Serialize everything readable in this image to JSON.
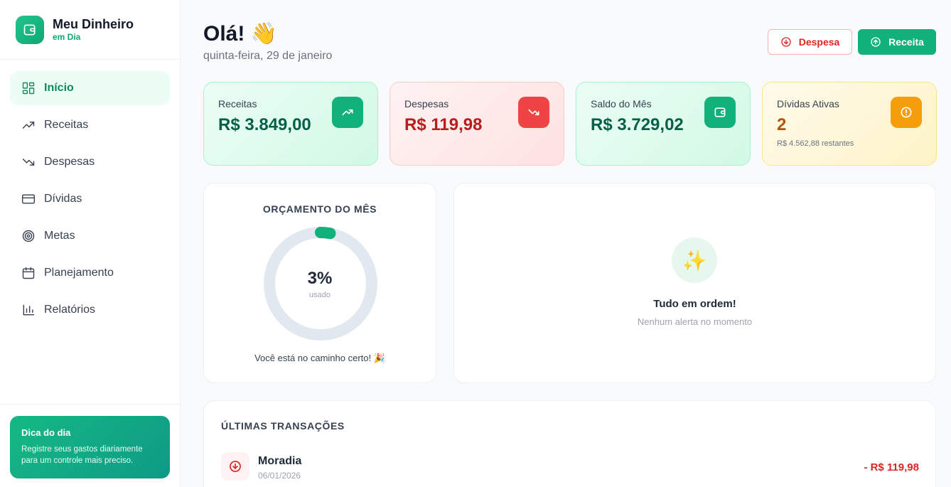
{
  "brand": {
    "title": "Meu Dinheiro",
    "subtitle": "em Dia",
    "icon": "wallet-icon"
  },
  "nav": [
    {
      "label": "Início",
      "icon": "grid-icon",
      "active": true
    },
    {
      "label": "Receitas",
      "icon": "trending-up-icon"
    },
    {
      "label": "Despesas",
      "icon": "trending-down-icon"
    },
    {
      "label": "Dívidas",
      "icon": "credit-card-icon"
    },
    {
      "label": "Metas",
      "icon": "target-icon"
    },
    {
      "label": "Planejamento",
      "icon": "calendar-icon"
    },
    {
      "label": "Relatórios",
      "icon": "bar-chart-icon"
    }
  ],
  "tip": {
    "title": "Dica do dia",
    "text": "Registre seus gastos diariamente para um controle mais preciso."
  },
  "header": {
    "greeting": "Olá! 👋",
    "date": "quinta-feira, 29 de janeiro"
  },
  "actions": {
    "expense_label": "Despesa",
    "income_label": "Receita"
  },
  "cards": [
    {
      "label": "Receitas",
      "value": "R$ 3.849,00",
      "icon": "trending-up-icon"
    },
    {
      "label": "Despesas",
      "value": "R$ 119,98",
      "icon": "trending-down-icon"
    },
    {
      "label": "Saldo do Mês",
      "value": "R$ 3.729,02",
      "icon": "wallet-icon"
    },
    {
      "label": "Dívidas Ativas",
      "value": "2",
      "sub": "R$ 4.562,88 restantes",
      "icon": "alert-circle-icon"
    }
  ],
  "budget": {
    "title": "ORÇAMENTO DO MÊS",
    "percent_label": "3%",
    "used_fraction": 0.03,
    "used_label": "usado",
    "message": "Você está no caminho certo! 🎉"
  },
  "alerts": {
    "title": "Tudo em ordem!",
    "subtitle": "Nenhum alerta no momento",
    "icon": "sparkles-icon"
  },
  "transactions": {
    "title": "ÚLTIMAS TRANSAÇÕES",
    "items": [
      {
        "name": "Moradia",
        "date": "06/01/2026",
        "amount": "- R$ 119,98"
      }
    ]
  },
  "colors": {
    "accent": "#12b07a",
    "danger": "#dc2626",
    "warning": "#f59e0b"
  }
}
